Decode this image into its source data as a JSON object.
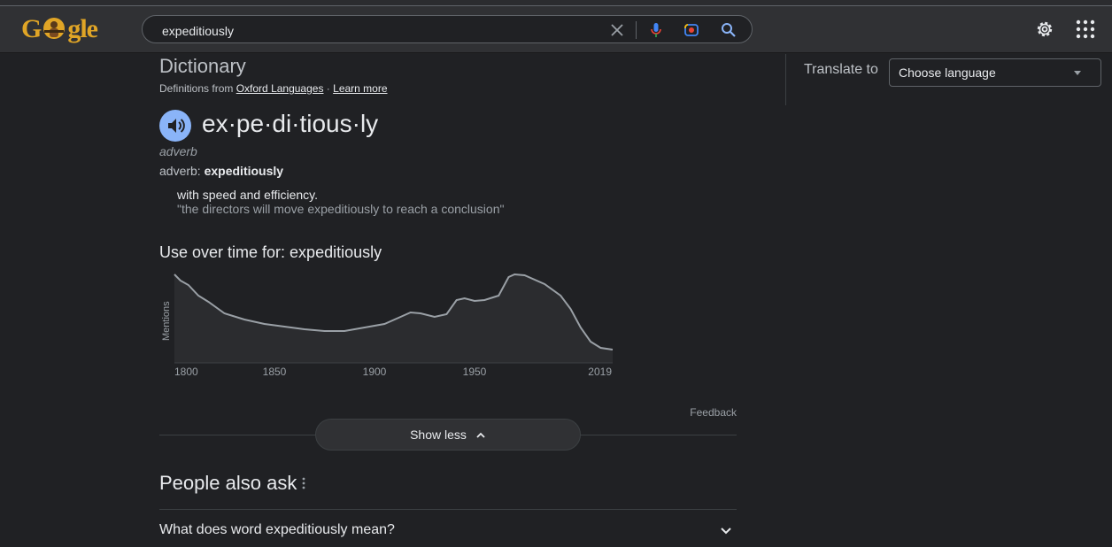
{
  "search": {
    "query": "expeditiously"
  },
  "logo": {
    "text": "Google"
  },
  "icons": {
    "clear": "close-icon",
    "mic": "microphone-icon",
    "lens": "camera-icon",
    "search": "search-icon",
    "settings": "gear-icon",
    "apps": "apps-grid-icon",
    "speaker": "speaker-icon",
    "chevron_up": "chevron-up-icon",
    "chevron_down": "chevron-down-icon"
  },
  "dictionary": {
    "title": "Dictionary",
    "source_prefix": "Definitions from",
    "source_link": "Oxford Languages",
    "source_sep": " · ",
    "learn_more": "Learn more",
    "headword": "ex·pe·di·tious·ly",
    "part_of_speech": "adverb",
    "forms_label": "adverb:",
    "forms_word": "expeditiously",
    "definition": "with speed and efficiency.",
    "example": "\"the directors will move expeditiously to reach a conclusion\""
  },
  "usage": {
    "title": "Use over time for: expeditiously"
  },
  "chart_data": {
    "type": "area",
    "ylabel": "Mentions",
    "x_ticks": [
      "1800",
      "1850",
      "1900",
      "1950",
      "2019"
    ],
    "x_range": [
      1800,
      2019
    ],
    "grid": false,
    "x": [
      1800,
      1803,
      1807,
      1812,
      1817,
      1825,
      1835,
      1845,
      1855,
      1865,
      1875,
      1885,
      1895,
      1905,
      1912,
      1918,
      1923,
      1930,
      1936,
      1941,
      1945,
      1950,
      1955,
      1962,
      1967,
      1970,
      1975,
      1985,
      1993,
      1998,
      2003,
      2008,
      2013,
      2019
    ],
    "values": [
      100,
      93,
      88,
      76,
      69,
      56,
      49,
      44,
      41,
      38,
      36,
      36,
      40,
      44,
      51,
      57,
      56,
      52,
      55,
      71,
      73,
      70,
      71,
      76,
      97,
      100,
      99,
      89,
      76,
      61,
      40,
      24,
      17,
      15
    ]
  },
  "feedback": "Feedback",
  "show_less": "Show less",
  "people_also_ask": {
    "title": "People also ask",
    "questions": [
      "What does word expeditiously mean?"
    ]
  },
  "translate": {
    "label": "Translate to",
    "placeholder": "Choose language"
  },
  "colors": {
    "accent": "#8ab4f8",
    "background": "#202124",
    "surface": "#303134"
  }
}
